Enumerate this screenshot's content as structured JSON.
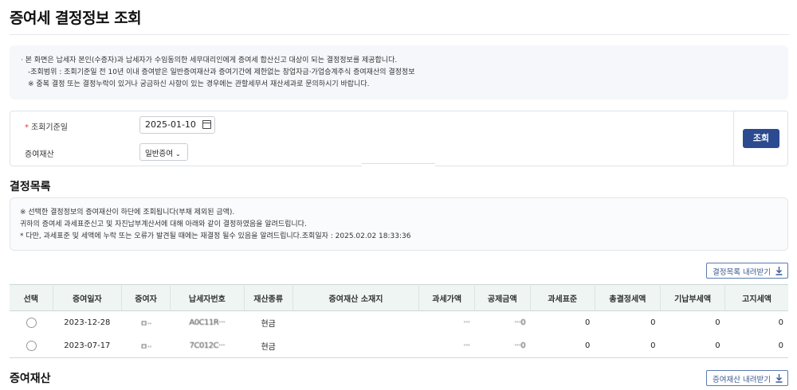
{
  "page_title": "증여세 결정정보 조회",
  "notice": {
    "line1": "본 화면은 납세자 본인(수증자)과 납세자가 수임동의한 세무대리인에게 증여세 합산신고 대상이 되는 결정정보를 제공합니다.",
    "line2": "-조회범위 : 조회기준일 전 10년 이내 증여받은 일반증여재산과 증여기간에 제한없는 창업자금·가업승계주식 증여재산의 결정정보",
    "line3": "※ 중복 결정 또는 결정누락이 있거나 궁금하신 사항이 있는 경우에는 관할세무서 재산세과로 문의하시기 바랍니다."
  },
  "search": {
    "date_label": "조회기준일",
    "date_value": "2025-01-10",
    "asset_label": "증여재산",
    "asset_value": "일반증여",
    "button": "조회"
  },
  "list_section": {
    "title": "결정목록",
    "notice_line1": "※ 선택한 결정정보의 증여재산이 하단에 조회됩니다(부채 제외된 금액).",
    "notice_line2": "귀하의 증여세 과세표준신고 및 자진납부계산서에 대해 아래와 같이 결정하였음을 알려드립니다.",
    "notice_line3": "* 다만, 과세표준 및 세액에 누락 또는 오류가 발견될 때에는 재결정 될수 있음을 알려드립니다.조회일자 : 2025.02.02 18:33:36",
    "download": "결정목록 내려받기"
  },
  "table": {
    "headers": [
      "선택",
      "증여일자",
      "증여자",
      "납세자번호",
      "재산종류",
      "증여재산 소재지",
      "과세가액",
      "공제금액",
      "과세표준",
      "총결정세액",
      "기납부세액",
      "고지세액"
    ],
    "rows": [
      {
        "date": "2023-12-28",
        "donor": "ㅁ··",
        "taxno": "A0C11R···",
        "kind": "현금",
        "location": "",
        "taxable": "···",
        "deduction": "···0",
        "base": "0",
        "total": "0",
        "paid": "0",
        "notice": "0"
      },
      {
        "date": "2023-07-17",
        "donor": "ㅁ··",
        "taxno": "7C012C···",
        "kind": "현금",
        "location": "",
        "taxable": "···",
        "deduction": "···0",
        "base": "0",
        "total": "0",
        "paid": "0",
        "notice": "0"
      }
    ]
  },
  "asset_section": {
    "title": "증여재산",
    "download": "증여재산 내려받기"
  }
}
